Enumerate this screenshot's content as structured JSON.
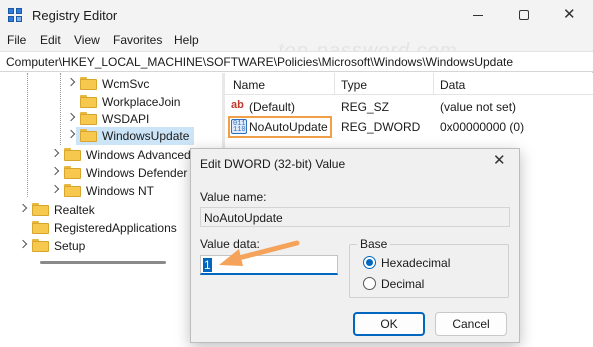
{
  "window": {
    "title": "Registry Editor",
    "controls": {
      "minimize": "minimize",
      "maximize": "maximize",
      "close": "✕"
    }
  },
  "menu": [
    "File",
    "Edit",
    "View",
    "Favorites",
    "Help"
  ],
  "address": "Computer\\HKEY_LOCAL_MACHINE\\SOFTWARE\\Policies\\Microsoft\\Windows\\WindowsUpdate",
  "watermark": "top-password.com",
  "tree": [
    {
      "label": "WcmSvc",
      "expandable": true,
      "selected": false
    },
    {
      "label": "WorkplaceJoin",
      "expandable": false,
      "selected": false
    },
    {
      "label": "WSDAPI",
      "expandable": true,
      "selected": false
    },
    {
      "label": "WindowsUpdate",
      "expandable": true,
      "selected": true
    },
    {
      "label": "Windows Advanced",
      "expandable": true,
      "selected": false
    },
    {
      "label": "Windows Defender",
      "expandable": true,
      "selected": false
    },
    {
      "label": "Windows NT",
      "expandable": true,
      "selected": false
    },
    {
      "label": "Realtek",
      "expandable": true,
      "selected": false
    },
    {
      "label": "RegisteredApplications",
      "expandable": false,
      "selected": false
    },
    {
      "label": "Setup",
      "expandable": true,
      "selected": false
    }
  ],
  "list": {
    "columns": [
      "Name",
      "Type",
      "Data"
    ],
    "rows": [
      {
        "icon": "string-value-icon",
        "name": "(Default)",
        "type": "REG_SZ",
        "data": "(value not set)"
      },
      {
        "icon": "binary-value-icon",
        "name": "NoAutoUpdate",
        "type": "REG_DWORD",
        "data": "0x00000000 (0)",
        "highlighted": true
      }
    ]
  },
  "dialog": {
    "title": "Edit DWORD (32-bit) Value",
    "close": "✕",
    "value_name_label": "Value name:",
    "value_name": "NoAutoUpdate",
    "value_data_label": "Value data:",
    "value_data": "1",
    "base_label": "Base",
    "base_options": [
      {
        "label": "Hexadecimal",
        "selected": true
      },
      {
        "label": "Decimal",
        "selected": false
      }
    ],
    "ok_label": "OK",
    "cancel_label": "Cancel"
  },
  "colors": {
    "accent": "#0067c0",
    "highlight_box": "#f0a048",
    "arrow": "#f5a35a",
    "selection": "#cce4f7",
    "folder": "#f6c94e"
  },
  "icons": {
    "app": "registry-editor-icon",
    "folder": "folder-icon",
    "chevron": "chevron-right-icon",
    "pointer": "arrow-annotation-icon"
  }
}
